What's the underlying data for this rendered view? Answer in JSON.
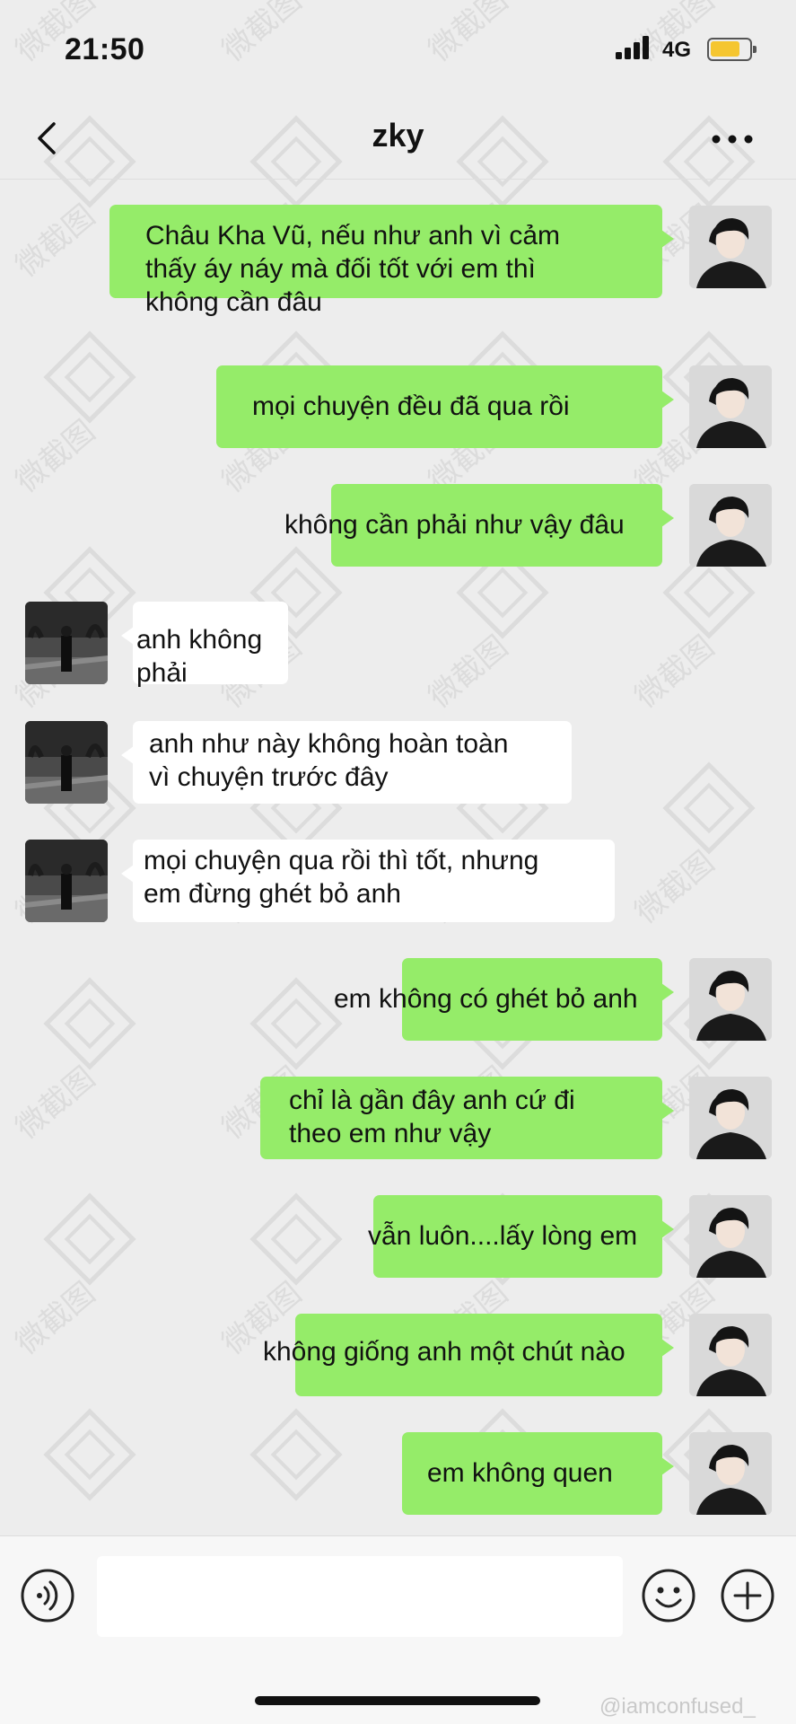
{
  "status_bar": {
    "time": "21:50",
    "network": "4G",
    "battery_color": "#f5c630"
  },
  "header": {
    "title": "zky"
  },
  "messages": [
    {
      "side": "sent",
      "text": "Châu Kha Vũ, nếu như anh vì cảm\nthấy áy náy mà đối tốt với em thì\nkhông cần đâu"
    },
    {
      "side": "sent",
      "text": "mọi chuyện đều đã qua rồi"
    },
    {
      "side": "sent",
      "text": "không cần phải như vậy đâu"
    },
    {
      "side": "received",
      "text": "anh không phải"
    },
    {
      "side": "received",
      "text": "anh như này không hoàn toàn\nvì chuyện trước đây"
    },
    {
      "side": "received",
      "text": "mọi chuyện qua rồi thì tốt, nhưng\nem đừng ghét bỏ anh"
    },
    {
      "side": "sent",
      "text": "em không có ghét bỏ anh"
    },
    {
      "side": "sent",
      "text": "chỉ là gần đây anh cứ đi\ntheo em như vậy"
    },
    {
      "side": "sent",
      "text": "vẫn luôn....lấy lòng em"
    },
    {
      "side": "sent",
      "text": "không giống anh một chút nào"
    },
    {
      "side": "sent",
      "text": "em không quen"
    }
  ],
  "input_bar": {
    "voice_icon": "voice-icon",
    "emoji_icon": "emoji-icon",
    "plus_icon": "plus-icon"
  },
  "watermark": {
    "text": "微截图",
    "credit": "@iamconfused_"
  },
  "colors": {
    "background": "#ededed",
    "sent_bubble": "#95ec69",
    "received_bubble": "#ffffff"
  }
}
